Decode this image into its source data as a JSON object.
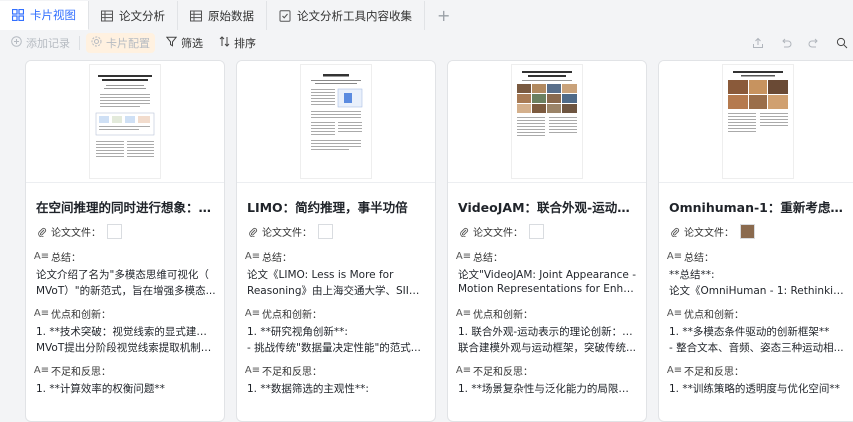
{
  "tabs": [
    {
      "label": "卡片视图",
      "icon": "grid-icon",
      "active": true
    },
    {
      "label": "论文分析",
      "icon": "table-icon",
      "active": false
    },
    {
      "label": "原始数据",
      "icon": "table-icon",
      "active": false
    },
    {
      "label": "论文分析工具内容收集",
      "icon": "form-icon",
      "active": false
    }
  ],
  "toolbar": {
    "add_record": "添加记录",
    "card_config": "卡片配置",
    "filter": "筛选",
    "sort": "排序"
  },
  "field_labels": {
    "file": "论文文件：",
    "summary": "总结：",
    "strengths": "优点和创新：",
    "weaknesses": "不足和反思："
  },
  "cards": [
    {
      "title": "在空间推理的同时进行想象：多...",
      "summary": [
        "论文介绍了名为\"多模态思维可视化（",
        "MVoT）\"的新范式，旨在增强多模态..."
      ],
      "strengths": [
        "1. **技术突破：视觉线索的显式建模**:",
        "MVoT提出分阶段视觉线索提取机制，..."
      ],
      "weaknesses": [
        "1. **计算效率的权衡问题**"
      ]
    },
    {
      "title": "LIMO：简约推理，事半功倍",
      "summary": [
        "论文《LIMO: Less is More for",
        "Reasoning》由上海交通大学、SII和..."
      ],
      "strengths": [
        "1. **研究视角创新**:",
        "   - 挑战传统\"数据量决定性能\"的范式..."
      ],
      "weaknesses": [
        "1. **数据筛选的主观性**:"
      ]
    },
    {
      "title": "VideoJAM：联合外观-运动表示...",
      "summary": [
        "论文\"VideoJAM: Joint Appearance -",
        "Motion Representations for Enhance..."
      ],
      "strengths": [
        "1. 联合外观-运动表示的理论创新：提出",
        "联合建模外观与运动框架，突破传统..."
      ],
      "weaknesses": [
        "1. **场景复杂性与泛化能力的局限性**"
      ]
    },
    {
      "title": "Omnihuman-1：重新考虑人类动...",
      "summary": [
        "**总结**:",
        "论文《OmniHuman - 1: Rethinking th..."
      ],
      "strengths": [
        "1. **多模态条件驱动的创新框架**",
        "  - 整合文本、音频、姿态三种运动相..."
      ],
      "weaknesses": [
        "1. **训练策略的透明度与优化空间**"
      ]
    }
  ],
  "colors": {
    "accent": "#3370ff",
    "tab_bg": "#f3f4f6",
    "card_bg": "#ffffff",
    "border": "#e1e3e6"
  }
}
